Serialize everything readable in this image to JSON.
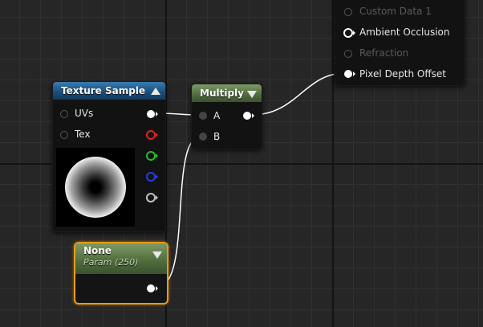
{
  "output_node": {
    "pins": [
      {
        "label": "Custom Data 1",
        "enabled": false
      },
      {
        "label": "Ambient Occlusion",
        "enabled": true
      },
      {
        "label": "Refraction",
        "enabled": false
      },
      {
        "label": "Pixel Depth Offset",
        "enabled": true
      }
    ]
  },
  "texture_sample_node": {
    "title": "Texture Sample",
    "inputs": [
      "UVs",
      "Tex"
    ],
    "output_pin_colors": [
      "#ffffff",
      "#e02020",
      "#20c020",
      "#2040e0",
      "#c0c0c0"
    ]
  },
  "multiply_node": {
    "title": "Multiply",
    "inputs": [
      "A",
      "B"
    ]
  },
  "param_node": {
    "title": "None",
    "subtitle": "Param (250)"
  },
  "colors": {
    "texture_header": "#1a4d7a",
    "math_header": "#4f6a3c",
    "selection_outline": "#e89a16",
    "wire": "#ffffff"
  }
}
